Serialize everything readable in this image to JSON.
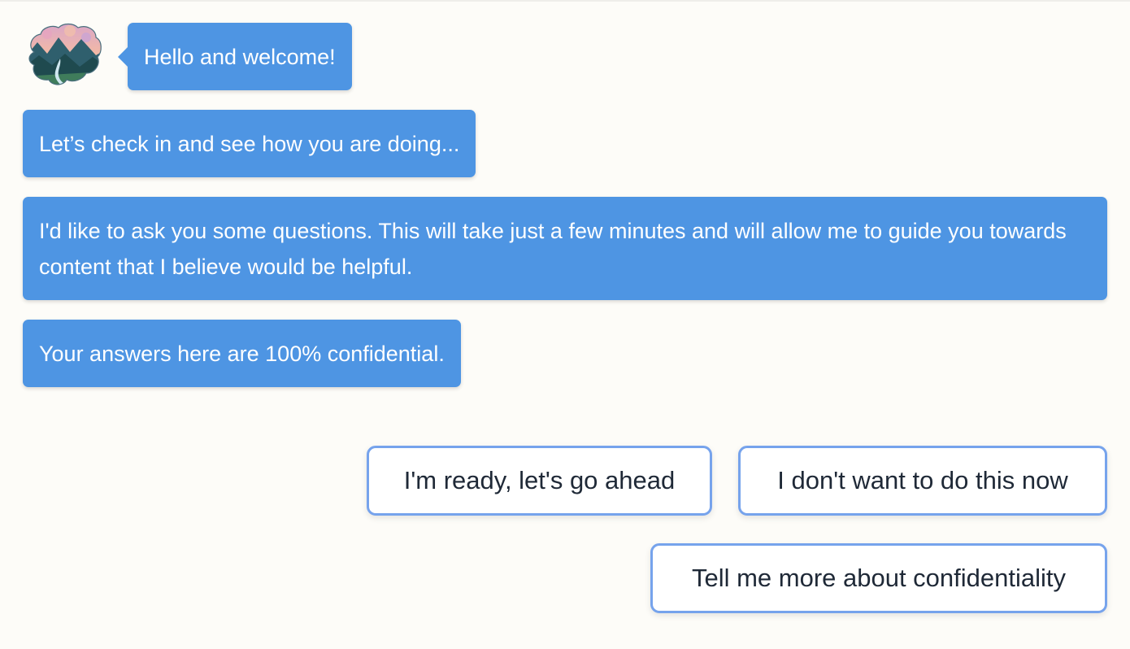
{
  "messages": [
    {
      "text": "Hello and welcome!"
    },
    {
      "text": "Let’s check in and see how you are doing..."
    },
    {
      "text": "I'd like to ask you some questions. This will take just a few minutes and will allow me to guide you towards content that I believe would be helpful."
    },
    {
      "text": "Your answers here are 100% confidential."
    }
  ],
  "answers": [
    {
      "label": "I'm ready, let's go ahead"
    },
    {
      "label": "I don't want to do this now"
    },
    {
      "label": "Tell me more about confidentiality"
    }
  ],
  "colors": {
    "bot_bubble": "#4e95e3",
    "answer_border": "#76a3ec",
    "background": "#fdfcf8"
  },
  "avatar": {
    "icon": "brain-landscape-icon"
  }
}
